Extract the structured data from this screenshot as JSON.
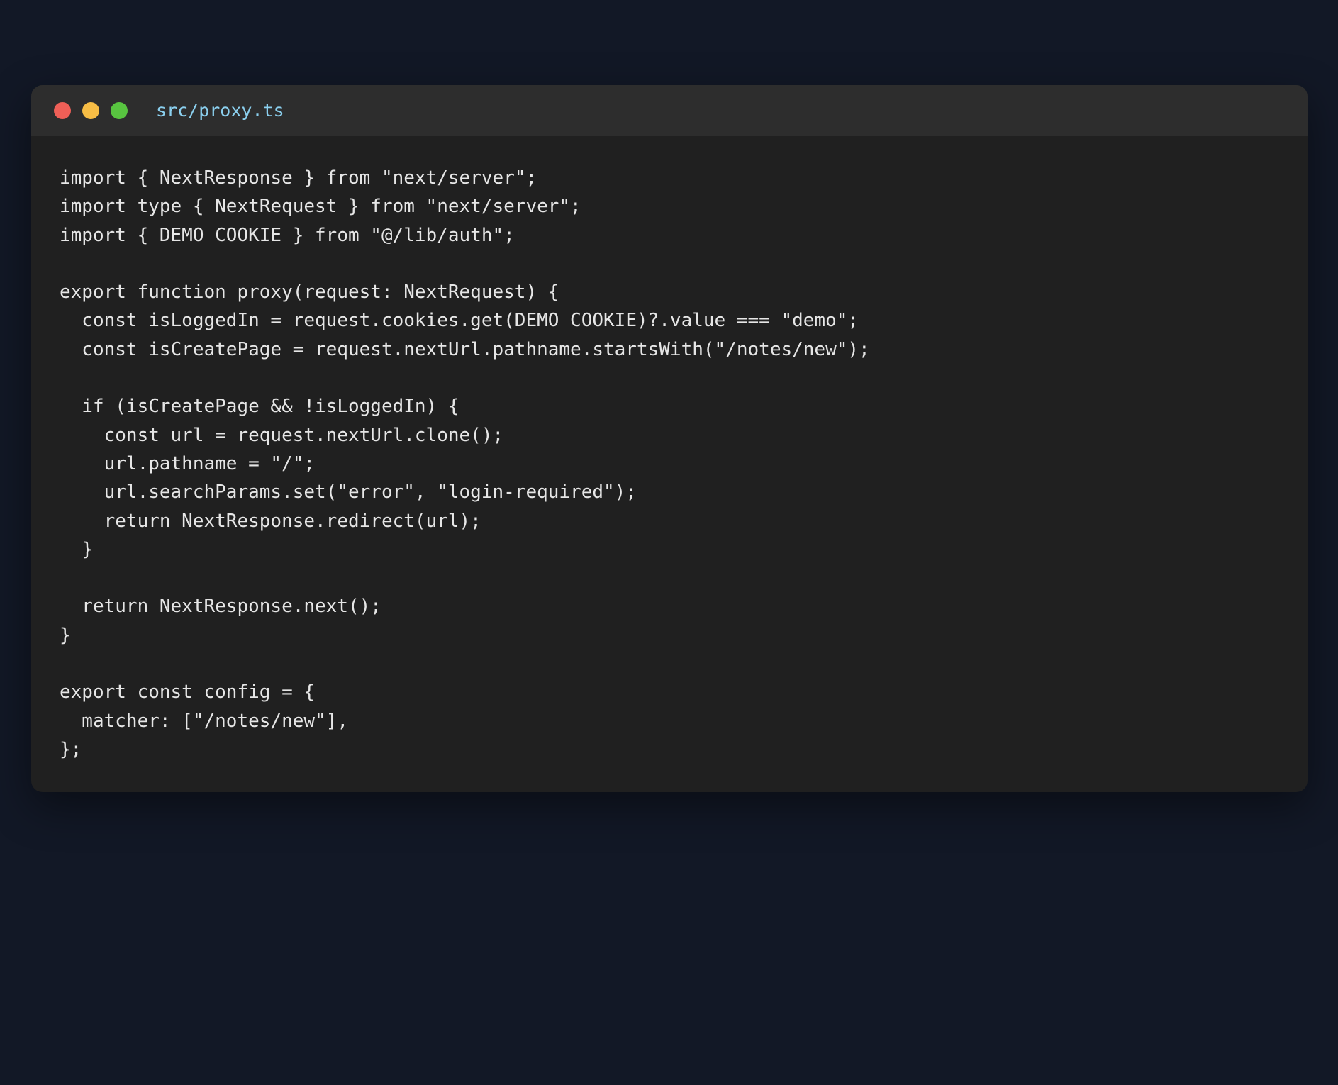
{
  "window": {
    "filename": "src/proxy.ts",
    "traffic_lights": {
      "close_color": "#ee5f57",
      "minimize_color": "#f7bd45",
      "maximize_color": "#58c440"
    }
  },
  "code": {
    "lines": [
      "import { NextResponse } from \"next/server\";",
      "import type { NextRequest } from \"next/server\";",
      "import { DEMO_COOKIE } from \"@/lib/auth\";",
      "",
      "export function proxy(request: NextRequest) {",
      "  const isLoggedIn = request.cookies.get(DEMO_COOKIE)?.value === \"demo\";",
      "  const isCreatePage = request.nextUrl.pathname.startsWith(\"/notes/new\");",
      "",
      "  if (isCreatePage && !isLoggedIn) {",
      "    const url = request.nextUrl.clone();",
      "    url.pathname = \"/\";",
      "    url.searchParams.set(\"error\", \"login-required\");",
      "    return NextResponse.redirect(url);",
      "  }",
      "",
      "  return NextResponse.next();",
      "}",
      "",
      "export const config = {",
      "  matcher: [\"/notes/new\"],",
      "};"
    ]
  }
}
